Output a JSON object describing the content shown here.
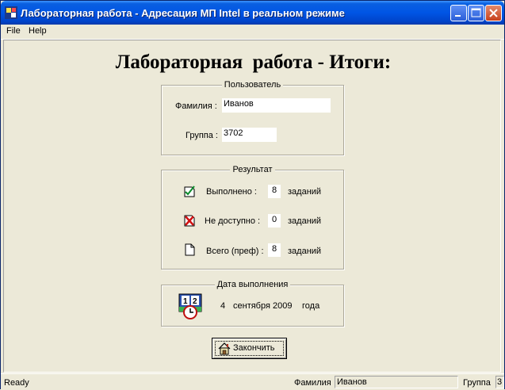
{
  "window": {
    "title": "Лабораторная работа - Адресация МП Intel в реальном режиме"
  },
  "menu": {
    "items": [
      "File",
      "Help"
    ]
  },
  "heading": "Лабораторная  работа - Итоги:",
  "user_group": {
    "legend": "Пользователь",
    "surname_label": "Фамилия :",
    "surname_value": "Иванов",
    "group_label": "Группа :",
    "group_value": "3702"
  },
  "result_group": {
    "legend": "Результат",
    "rows": [
      {
        "label": "Выполнено  :",
        "value": "8",
        "unit": "заданий",
        "icon": "checked-document-icon"
      },
      {
        "label": "Не доступно  :",
        "value": "0",
        "unit": "заданий",
        "icon": "crossed-document-icon"
      },
      {
        "label": "Всего (преф) :",
        "value": "8",
        "unit": "заданий",
        "icon": "blank-document-icon"
      }
    ]
  },
  "date_group": {
    "legend": "Дата выполнения",
    "day": "4",
    "month": "сентября",
    "year": "2009",
    "suffix": "года",
    "icon": "calendar-clock-icon"
  },
  "finish_button": {
    "label": "Закончить",
    "icon": "home-icon"
  },
  "statusbar": {
    "status": "Ready",
    "surname_label": "Фамилия",
    "surname_value": "Иванов",
    "group_label": "Группа",
    "group_value": "3"
  },
  "colors": {
    "titlebar": "#0055e5",
    "face": "#ece9d8",
    "field": "#ffffff"
  }
}
